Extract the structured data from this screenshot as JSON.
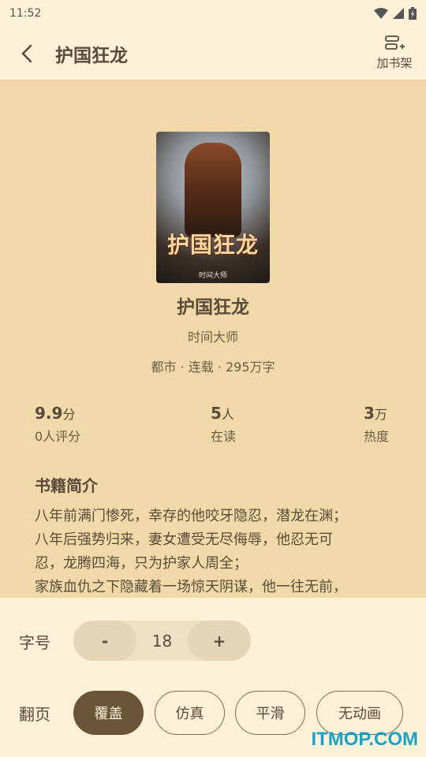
{
  "status": {
    "time": "11:52"
  },
  "header": {
    "title": "护国狂龙",
    "add_shelf_label": "加书架"
  },
  "book": {
    "cover_title": "护国狂龙",
    "cover_author": "时间大师",
    "name": "护国狂龙",
    "author": "时间大师",
    "meta": "都市 · 连载 · 295万字"
  },
  "stats": [
    {
      "value": "9.9",
      "unit": "分",
      "label": "0人评分"
    },
    {
      "value": "5",
      "unit": "人",
      "label": "在读"
    },
    {
      "value": "3",
      "unit": "万",
      "label": "热度"
    }
  ],
  "intro": {
    "title": "书籍简介",
    "lines": [
      "八年前满门惨死，幸存的他咬牙隐忍，潜龙在渊；",
      "八年后强势归来，妻女遭受无尽侮辱，他忍无可",
      "忍，龙腾四海，只为护家人周全；",
      "家族血仇之下隐藏着一场惊天阴谋，他一往无前，"
    ]
  },
  "settings": {
    "font_size_label": "字号",
    "minus": "-",
    "font_size_value": "18",
    "plus": "+",
    "page_turn_label": "翻页",
    "page_options": [
      "覆盖",
      "仿真",
      "平滑",
      "无动画"
    ],
    "selected_option": "覆盖"
  },
  "watermark": "ITMOP.COM"
}
